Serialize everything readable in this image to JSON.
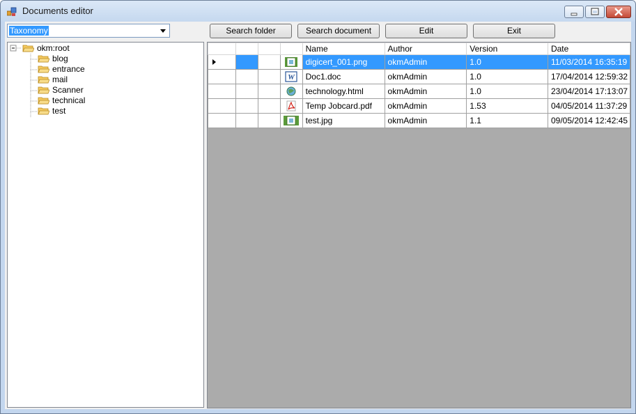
{
  "window": {
    "title": "Documents editor",
    "buttons": {
      "minimize": "minimize",
      "maximize": "maximize",
      "close": "close"
    }
  },
  "toolbar": {
    "combo_value": "Taxonomy",
    "search_folder": "Search folder",
    "search_document": "Search document",
    "edit": "Edit",
    "exit": "Exit"
  },
  "tree": {
    "root": "okm:root",
    "children": [
      "blog",
      "entrance",
      "mail",
      "Scanner",
      "technical",
      "test"
    ]
  },
  "grid": {
    "columns": [
      "Name",
      "Author",
      "Version",
      "Date"
    ],
    "rows": [
      {
        "icon": "image-file-icon",
        "name": "digicert_001.png",
        "author": "okmAdmin",
        "version": "1.0",
        "date": "11/03/2014 16:35:19",
        "selected": true
      },
      {
        "icon": "word-doc-icon",
        "name": "Doc1.doc",
        "author": "okmAdmin",
        "version": "1.0",
        "date": "17/04/2014 12:59:32",
        "selected": false
      },
      {
        "icon": "html-file-icon",
        "name": "technology.html",
        "author": "okmAdmin",
        "version": "1.0",
        "date": "23/04/2014 17:13:07",
        "selected": false
      },
      {
        "icon": "pdf-file-icon",
        "name": "Temp Jobcard.pdf",
        "author": "okmAdmin",
        "version": "1.53",
        "date": "04/05/2014 11:37:29",
        "selected": false
      },
      {
        "icon": "image-file-icon",
        "name": "test.jpg",
        "author": "okmAdmin",
        "version": "1.1",
        "date": "09/05/2014 12:42:45",
        "selected": false
      }
    ]
  },
  "colors": {
    "selection": "#3399ff",
    "grid_background": "#ababab",
    "window_frame": "#c3d6ee"
  }
}
